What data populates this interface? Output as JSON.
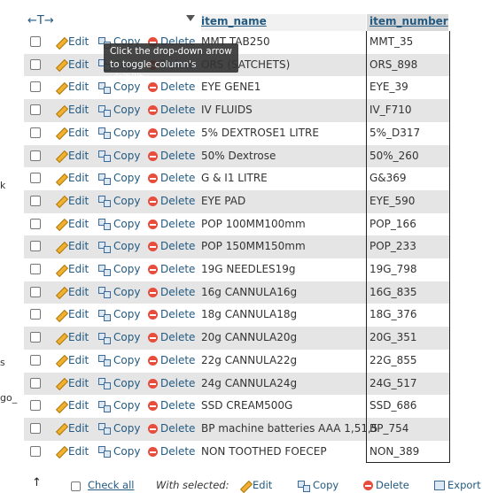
{
  "header": {
    "arrows": "←T→",
    "col_name": "item_name",
    "col_number": "item_number"
  },
  "actions": {
    "edit": "Edit",
    "copy": "Copy",
    "delete": "Delete"
  },
  "tooltip": "Click the drop-down arrow to toggle column's visibility.",
  "rows": [
    {
      "name": "MMT TAB250",
      "number": "MMT_35"
    },
    {
      "name": "ORS (SATCHETS)",
      "number": "ORS_898"
    },
    {
      "name": "EYE GENE1",
      "number": "EYE_39"
    },
    {
      "name": "IV FLUIDS",
      "number": "IV_F710"
    },
    {
      "name": "5% DEXTROSE1 LITRE",
      "number": "5%_D317"
    },
    {
      "name": "50% Dextrose",
      "number": "50%_260"
    },
    {
      "name": "G & I1 LITRE",
      "number": "G&369"
    },
    {
      "name": "EYE PAD",
      "number": "EYE_590"
    },
    {
      "name": "POP 100MM100mm",
      "number": "POP_166"
    },
    {
      "name": "POP 150MM150mm",
      "number": "POP_233"
    },
    {
      "name": "19G NEEDLES19g",
      "number": "19G_798"
    },
    {
      "name": "16g CANNULA16g",
      "number": "16G_835"
    },
    {
      "name": "18g CANNULA18g",
      "number": "18G_376"
    },
    {
      "name": "20g CANNULA20g",
      "number": "20G_351"
    },
    {
      "name": "22g CANNULA22g",
      "number": "22G_855"
    },
    {
      "name": "24g CANNULA24g",
      "number": "24G_517"
    },
    {
      "name": "SSD CREAM500G",
      "number": "SSD_686"
    },
    {
      "name": "BP  machine batteries AAA 1,51,5",
      "number": "BP_754"
    },
    {
      "name": "NON TOOTHED FOECEP",
      "number": "NON_389"
    }
  ],
  "edge_fragments": [
    "k",
    "s",
    "go_"
  ],
  "footer": {
    "check_all": "Check all",
    "with_selected": "With selected:",
    "edit": "Edit",
    "copy": "Copy",
    "delete": "Delete",
    "export": "Export"
  },
  "colors": {
    "link": "#235a81",
    "row_alt": "#e5e5e5",
    "delete_icon": "#e74c3c"
  }
}
